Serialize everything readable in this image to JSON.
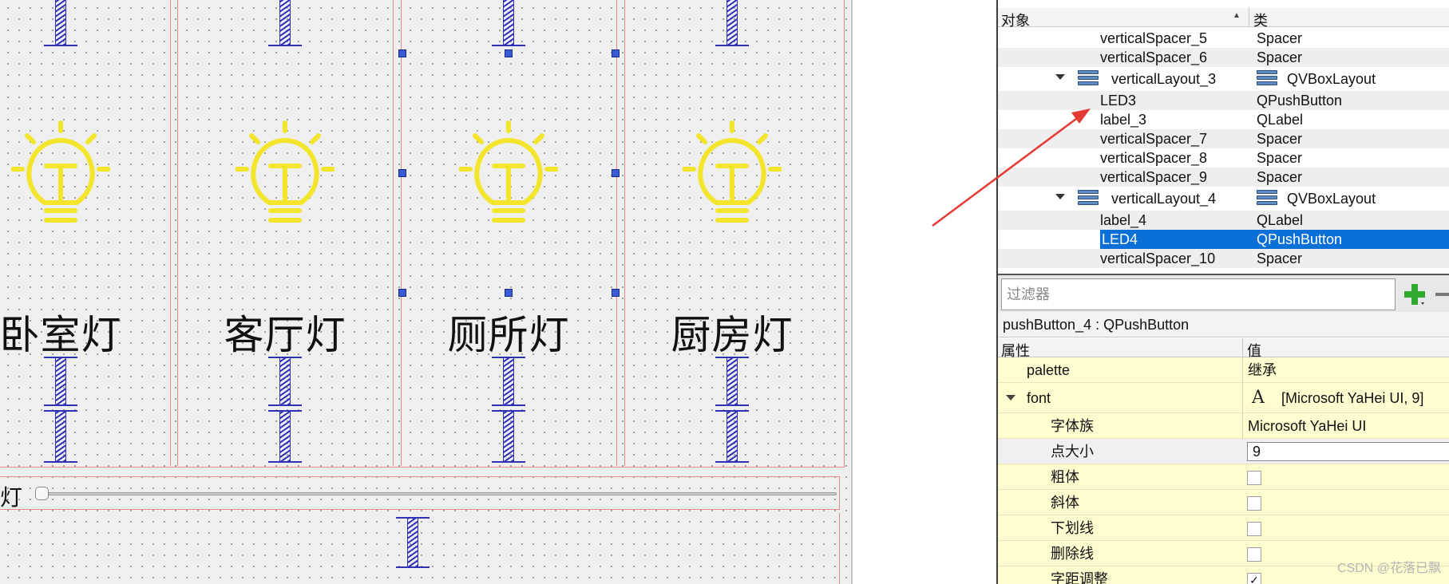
{
  "canvas": {
    "lamps": [
      {
        "label": "卧室灯"
      },
      {
        "label": "客厅灯"
      },
      {
        "label": "厕所灯"
      },
      {
        "label": "厨房灯"
      }
    ],
    "slider_label_fragment": "灯"
  },
  "object_inspector": {
    "header": {
      "col_object": "对象",
      "col_class": "类"
    },
    "rows": [
      {
        "name": "verticalSpacer_5",
        "class": "Spacer"
      },
      {
        "name": "verticalSpacer_6",
        "class": "Spacer"
      },
      {
        "name": "verticalLayout_3",
        "class": "QVBoxLayout",
        "layout": true
      },
      {
        "name": "LED3",
        "class": "QPushButton"
      },
      {
        "name": "label_3",
        "class": "QLabel"
      },
      {
        "name": "verticalSpacer_7",
        "class": "Spacer"
      },
      {
        "name": "verticalSpacer_8",
        "class": "Spacer"
      },
      {
        "name": "verticalSpacer_9",
        "class": "Spacer"
      },
      {
        "name": "verticalLayout_4",
        "class": "QVBoxLayout",
        "layout": true
      },
      {
        "name": "label_4",
        "class": "QLabel"
      },
      {
        "name": "LED4",
        "class": "QPushButton",
        "selected": true
      },
      {
        "name": "verticalSpacer_10",
        "class": "Spacer"
      }
    ]
  },
  "property_editor": {
    "filter_placeholder": "过滤器",
    "object_line": "pushButton_4 : QPushButton",
    "header": {
      "col_property": "属性",
      "col_value": "值"
    },
    "rows": [
      {
        "name": "palette",
        "value": "继承"
      },
      {
        "name": "font",
        "value": "[Microsoft YaHei UI, 9]"
      },
      {
        "name": "字体族",
        "value": "Microsoft YaHei UI"
      },
      {
        "name": "点大小",
        "value": "9"
      },
      {
        "name": "粗体",
        "value": ""
      },
      {
        "name": "斜体",
        "value": ""
      },
      {
        "name": "下划线",
        "value": ""
      },
      {
        "name": "删除线",
        "value": ""
      },
      {
        "name": "字距调整",
        "value": "✓"
      }
    ]
  },
  "watermark": "CSDN @花落已飘",
  "colors": {
    "selection": "#0a6fd6",
    "property_row": "#fefdd0",
    "spring": "#2f2fb8",
    "bulb": "#f2e52b",
    "layout_border": "#e88a8a",
    "arrow": "#e53935"
  }
}
